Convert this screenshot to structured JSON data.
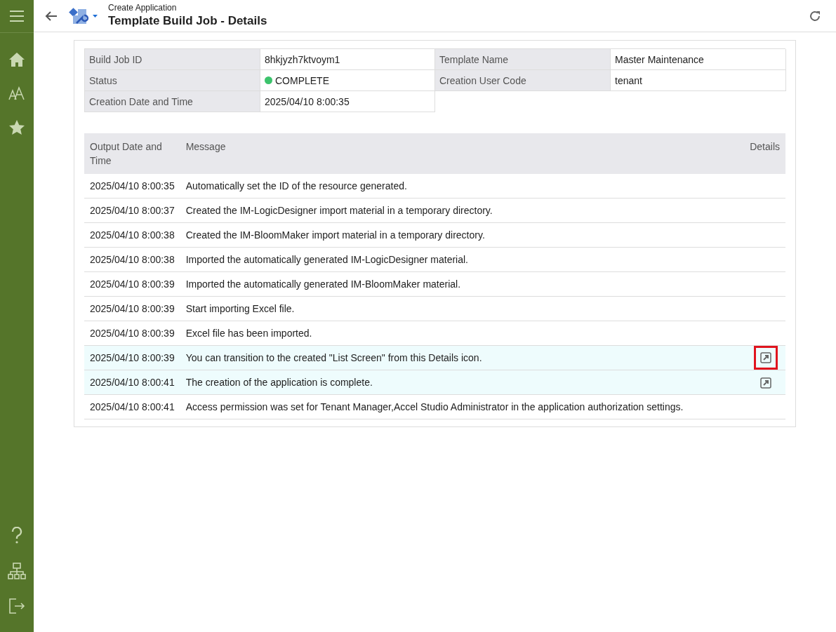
{
  "header": {
    "breadcrumb": "Create Application",
    "title": "Template Build Job - Details"
  },
  "info": [
    {
      "label": "Build Job ID",
      "value": "8hkjyzh7ktvoym1"
    },
    {
      "label": "Template Name",
      "value": "Master Maintenance"
    },
    {
      "label": "Status",
      "value": "COMPLETE",
      "color": "#3cc36c"
    },
    {
      "label": "Creation User Code",
      "value": "tenant"
    },
    {
      "label": "Creation Date and Time",
      "value": "2025/04/10 8:00:35"
    }
  ],
  "table": {
    "columns": [
      "Output Date and Time",
      "Message",
      "Details"
    ],
    "rows": [
      {
        "time": "2025/04/10 8:00:35",
        "message": "Automatically set the ID of the resource generated.",
        "details_link": false,
        "highlighted": false
      },
      {
        "time": "2025/04/10 8:00:37",
        "message": "Created the IM-LogicDesigner import material in a temporary directory.",
        "details_link": false,
        "highlighted": false
      },
      {
        "time": "2025/04/10 8:00:38",
        "message": "Created the IM-BloomMaker import material in a temporary directory.",
        "details_link": false,
        "highlighted": false
      },
      {
        "time": "2025/04/10 8:00:38",
        "message": "Imported the automatically generated IM-LogicDesigner material.",
        "details_link": false,
        "highlighted": false
      },
      {
        "time": "2025/04/10 8:00:39",
        "message": "Imported the automatically generated IM-BloomMaker material.",
        "details_link": false,
        "highlighted": false
      },
      {
        "time": "2025/04/10 8:00:39",
        "message": "Start importing Excel file.",
        "details_link": false,
        "highlighted": false
      },
      {
        "time": "2025/04/10 8:00:39",
        "message": "Excel file has been imported.",
        "details_link": false,
        "highlighted": false
      },
      {
        "time": "2025/04/10 8:00:39",
        "message": "You can transition to the created \"List Screen\" from this Details icon.",
        "details_link": true,
        "highlighted": true
      },
      {
        "time": "2025/04/10 8:00:41",
        "message": "The creation of the application is complete.",
        "details_link": true,
        "highlighted": false
      },
      {
        "time": "2025/04/10 8:00:41",
        "message": "Access permission was set for Tenant Manager,Accel Studio Administrator in the application authorization settings.",
        "details_link": false,
        "highlighted": false
      }
    ]
  }
}
